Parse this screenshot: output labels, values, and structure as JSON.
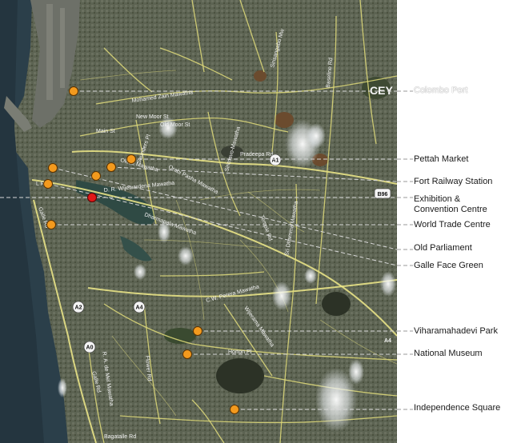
{
  "places": [
    {
      "id": "colombo-port",
      "label": "Colombo Port"
    },
    {
      "id": "pettah-market",
      "label": "Pettah Market"
    },
    {
      "id": "fort-railway-station",
      "label": "Fort Railway Station"
    },
    {
      "id": "exhibition-convention-centre",
      "label": "Exhibition & Convention Centre"
    },
    {
      "id": "world-trade-centre",
      "label": "World Trade Centre"
    },
    {
      "id": "old-parliament",
      "label": "Old Parliament"
    },
    {
      "id": "galle-face-green",
      "label": "Galle Face Green"
    },
    {
      "id": "viharamahadevi-park",
      "label": "Viharamahadevi Park"
    },
    {
      "id": "national-museum",
      "label": "National Museum"
    },
    {
      "id": "independence-square",
      "label": "Independence Square"
    }
  ],
  "road_labels": {
    "main_st": "Main St",
    "new_moor_st": "New Moor St",
    "old_moor_st": "Old Moor St",
    "mohamed_zain": "Mohamed Zain Mawatha",
    "saunders": "Saunders Pl",
    "ols_mawatha": "Olcott Mawatha",
    "orabi_pasha": "Orabi Pasha Mawatha",
    "srimavo": "Sirimavo-Mawatha",
    "pradeepa": "Pradeepa Rd",
    "dr_wije": "D. R. Wijewardena Mawatha",
    "ljr": "L R D",
    "galle_rd": "Galle Rd",
    "vt_mawatha": "Dharmapala Mawatha",
    "temple_rd": "Temple Rd",
    "dhamma": "Sri Dhamma Mawatha",
    "cw_perera": "C.W. Perera Mawatha",
    "horton": "Horton Pl",
    "ward": "Wijerama Mawatha",
    "flower": "Flower Rd",
    "rak": "R. A. de Mel Mawatha",
    "galle_rd2": "Galle Rd",
    "bagatalle": "Bagatalle Rd",
    "baseline": "Baseline Rd",
    "sujataya": "Sirisangabo Mw"
  },
  "shields": {
    "a1": "A1",
    "a2": "A2",
    "a4": "A4",
    "a0": "A0",
    "b96": "B96",
    "a4b": "A4"
  },
  "corner_watermark": "CEY",
  "colors": {
    "marker": "#f39a1e",
    "marker_selected": "#e01818",
    "road": "#f0ea8a"
  }
}
